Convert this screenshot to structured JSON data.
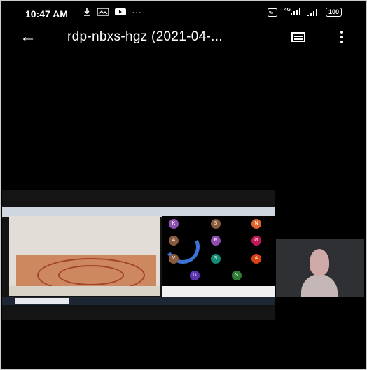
{
  "status_bar": {
    "time": "10:47 AM",
    "network": "4G",
    "battery": "100",
    "icons": [
      "download-icon",
      "gallery-icon",
      "youtube-icon",
      "overflow-dots-icon",
      "volte-icon",
      "signal-icon",
      "signal-icon-2",
      "battery-icon"
    ]
  },
  "app_bar": {
    "title": "rdp-nbxs-hgz (2021-04-...",
    "back_icon": "arrow-left-icon",
    "chat_icon": "chat-icon",
    "more_icon": "more-vert-icon"
  },
  "participants": [
    "K",
    "S",
    "N",
    "A",
    "R",
    "G",
    "V",
    "S",
    "A",
    "G",
    "S"
  ],
  "colors": {
    "background": "#000000",
    "spinner": "#3a74d4"
  }
}
